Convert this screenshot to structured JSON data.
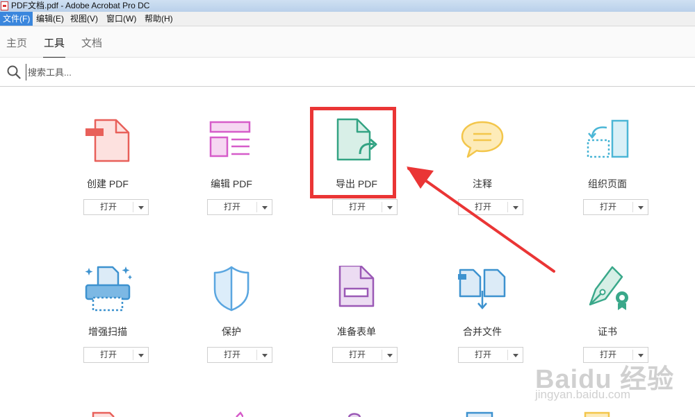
{
  "window": {
    "title": "PDF文档.pdf - Adobe Acrobat Pro DC"
  },
  "menu": [
    {
      "label": "文件(F)",
      "active": true
    },
    {
      "label": "编辑(E)"
    },
    {
      "label": "视图(V)"
    },
    {
      "label": "窗口(W)"
    },
    {
      "label": "帮助(H)"
    }
  ],
  "tabs": [
    {
      "label": "主页"
    },
    {
      "label": "工具",
      "active": true
    },
    {
      "label": "文档"
    }
  ],
  "search": {
    "placeholder": "搜索工具..."
  },
  "open_label": "打开",
  "tools": [
    {
      "name": "创建 PDF",
      "icon": "create-pdf-icon"
    },
    {
      "name": "编辑 PDF",
      "icon": "edit-pdf-icon"
    },
    {
      "name": "导出 PDF",
      "icon": "export-pdf-icon",
      "highlighted": true
    },
    {
      "name": "注释",
      "icon": "comment-icon"
    },
    {
      "name": "组织页面",
      "icon": "organize-pages-icon"
    },
    {
      "name": "增强扫描",
      "icon": "enhance-scan-icon"
    },
    {
      "name": "保护",
      "icon": "protect-shield-icon"
    },
    {
      "name": "准备表单",
      "icon": "prepare-form-icon"
    },
    {
      "name": "合并文件",
      "icon": "combine-files-icon"
    },
    {
      "name": "证书",
      "icon": "certificate-pen-icon"
    }
  ],
  "watermark": {
    "text": "Baidu 经验",
    "url": "jingyan.baidu.com"
  },
  "colors": {
    "menu_active": "#3a86dd",
    "highlight": "#ea3535",
    "create_pdf": "#e8605a",
    "edit_pdf": "#d65cc9",
    "export_pdf": "#33a383",
    "comment": "#f3c64b",
    "organize": "#4bb6d6",
    "scan": "#3d92cf",
    "protect": "#5aa6e0",
    "form": "#9b59b6",
    "combine": "#3d92cf",
    "certificate": "#3aa88a"
  }
}
